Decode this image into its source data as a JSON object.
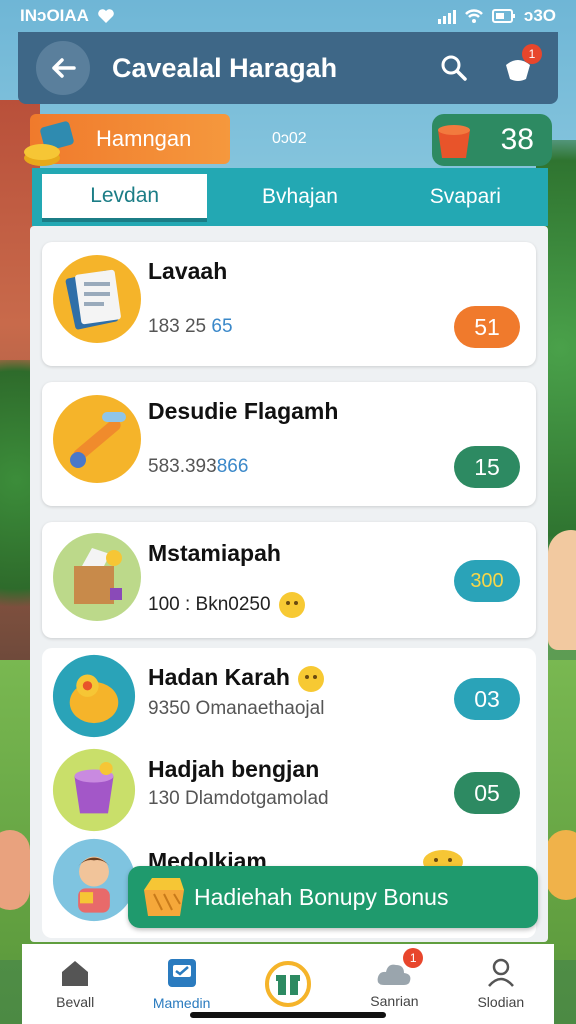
{
  "status_bar": {
    "left": "INɔOIAA",
    "right": "ɔ3O"
  },
  "header": {
    "title": "Cavealal Haragah",
    "notification_count": "1"
  },
  "banner": {
    "label": "Hamngan",
    "middle_text": "0ɔ02",
    "counter": "38"
  },
  "tabs": [
    {
      "label": "Levdan",
      "active": true
    },
    {
      "label": "Bvhajan",
      "active": false
    },
    {
      "label": "Svapari",
      "active": false
    }
  ],
  "items": [
    {
      "title": "Lavaah",
      "sub_prefix": "183 25",
      "sub_highlight": "65",
      "value": "51",
      "color": "#f07a2c"
    },
    {
      "title": "Desudie Flagamh",
      "sub_prefix": "583.393",
      "sub_highlight": "866",
      "value": "15",
      "color": "#2d8a62"
    },
    {
      "title": "Mstamiapah",
      "sub_prefix": "100 : Bkn0250",
      "sub_highlight": "",
      "value": "300",
      "color": "#2aa3b8"
    },
    {
      "title": "Hadan Karah",
      "sub_prefix": "9350 Omanaethaojal",
      "sub_highlight": "",
      "value": "03",
      "color": "#2aa3b8"
    },
    {
      "title": "Hadjah bengjan",
      "sub_prefix": "130   Dlamdotgamolad",
      "sub_highlight": "",
      "value": "05",
      "color": "#2d8a62"
    },
    {
      "title": "Medolkiam",
      "sub_prefix": "",
      "sub_highlight": "",
      "value": "",
      "color": ""
    }
  ],
  "bonus": {
    "label": "Hadiehah Bonupy Bonus"
  },
  "bottom_nav": [
    {
      "label": "Bevall",
      "icon": "home-icon",
      "active": false
    },
    {
      "label": "Mamedin",
      "icon": "tasks-icon",
      "active": true
    },
    {
      "label": "",
      "icon": "gift-icon",
      "active": false
    },
    {
      "label": "Sanrian",
      "icon": "cloud-icon",
      "active": false,
      "badge": "1"
    },
    {
      "label": "Slodian",
      "icon": "profile-icon",
      "active": false
    }
  ]
}
